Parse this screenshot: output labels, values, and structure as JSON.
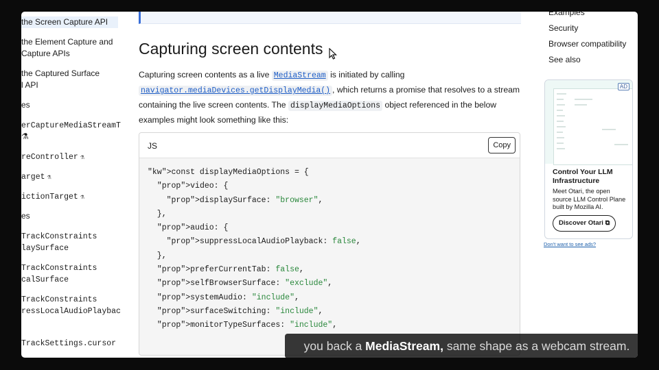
{
  "sidebar": {
    "items": [
      "the Screen Capture API",
      "the Element Capture and",
      "Capture APIs",
      "the Captured Surface",
      "l API",
      "es",
      "erCaptureMediaStreamT",
      "⚗",
      "reController",
      "arget",
      "ictionTarget",
      "es",
      "TrackConstraints",
      "laySurface",
      "TrackConstraints",
      "calSurface",
      "TrackConstraints",
      "ressLocalAudioPlaybac",
      "TrackSettings.cursor"
    ]
  },
  "main": {
    "heading": "Capturing screen contents",
    "para": {
      "t1": "Capturing screen contents as a live ",
      "link1": "MediaStream",
      "t2": " is initiated by calling ",
      "link2": "navigator.mediaDevices.getDisplayMedia()",
      "t3": ", which returns a promise that resolves to a stream containing the live screen contents. The ",
      "code1": "displayMediaOptions",
      "t4": " object referenced in the below examples might look something like this:"
    },
    "code": {
      "lang": "JS",
      "copy_label": "Copy",
      "lines": [
        "const displayMediaOptions = {",
        "  video: {",
        "    displaySurface: \"browser\",",
        "  },",
        "  audio: {",
        "    suppressLocalAudioPlayback: false,",
        "  },",
        "  preferCurrentTab: false,",
        "  selfBrowserSurface: \"exclude\",",
        "  systemAudio: \"include\",",
        "  surfaceSwitching: \"include\",",
        "  monitorTypeSurfaces: \"include\","
      ]
    },
    "caption": {
      "before": "you back a ",
      "bold": "MediaStream,",
      "after": " same shape as a webcam stream."
    }
  },
  "toc": {
    "items": [
      "Examples",
      "Security",
      "Browser compatibility",
      "See also"
    ]
  },
  "ad": {
    "badge": "AD",
    "title": "Control Your LLM Infrastructure",
    "text": "Meet Otari, the open source LLM Control Plane built by Mozilla AI.",
    "button": "Discover Otari ⧉",
    "dont_want": "Don't want to see ads?"
  },
  "colors": {
    "accent_link": "#1d5dc6",
    "code_prop": "#b3245b",
    "code_string": "#29873b",
    "code_keyword": "#1b5eaa"
  }
}
